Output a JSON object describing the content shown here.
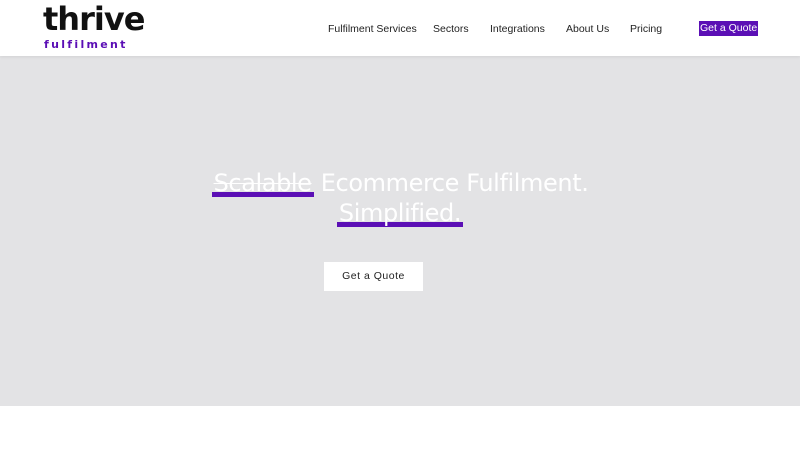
{
  "brand": {
    "name": "thrive",
    "tagline": "fulfilment",
    "accent_color": "#5b0fb5"
  },
  "nav": {
    "items": [
      {
        "label": "Fulfilment Services"
      },
      {
        "label": "Sectors"
      },
      {
        "label": "Integrations"
      },
      {
        "label": "About Us"
      },
      {
        "label": "Pricing"
      }
    ],
    "cta_label": "Get a Quote"
  },
  "hero": {
    "headline_part1": "Scalable",
    "headline_part2": "Ecommerce Fulfilment.",
    "headline_part3": "Simplified.",
    "cta_label": "Get a Quote",
    "background_color": "#e3e3e5"
  }
}
